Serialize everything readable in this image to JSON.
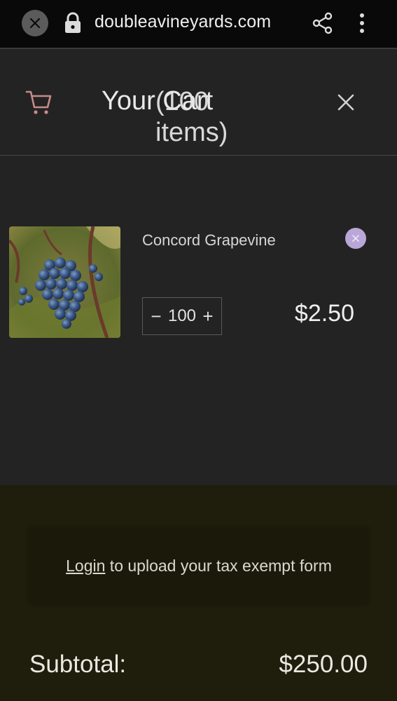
{
  "browser": {
    "url": "doubleavineyards.com",
    "close_icon": "close-icon",
    "lock_icon": "lock-icon",
    "share_icon": "share-icon",
    "menu_icon": "more-vertical-icon"
  },
  "cart": {
    "title": "Your Cart",
    "count_text": "(100 items)",
    "cart_icon": "cart-icon",
    "close_icon": "close-icon",
    "accent_color": "#c78a87"
  },
  "items": [
    {
      "name": "Concord Grapevine",
      "quantity": "100",
      "price": "$2.50",
      "remove_icon": "remove-icon",
      "remove_color": "#b9a7d8",
      "image": "grapes-photo"
    }
  ],
  "qty_controls": {
    "minus": "−",
    "plus": "+"
  },
  "footer": {
    "login_link": "Login",
    "tax_text": " to upload your tax exempt form",
    "subtotal_label": "Subtotal:",
    "subtotal_value": "$250.00",
    "background_color": "#1f1e0c"
  }
}
